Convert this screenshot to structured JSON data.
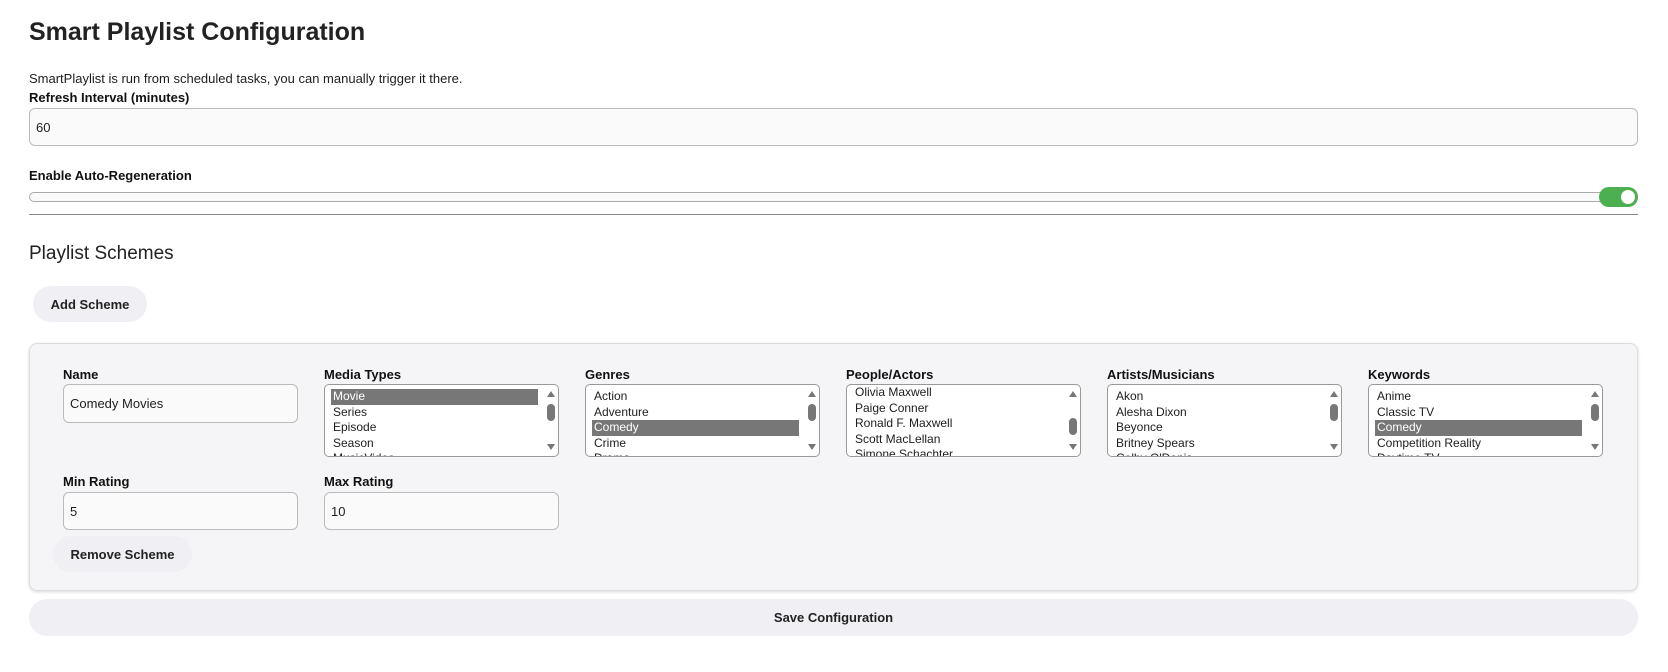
{
  "title": "Smart Playlist Configuration",
  "description": "SmartPlaylist is run from scheduled tasks, you can manually trigger it there.",
  "refresh": {
    "label": "Refresh Interval (minutes)",
    "value": "60"
  },
  "auto_regen": {
    "label": "Enable Auto-Regeneration",
    "enabled": true,
    "color": "#4caf50"
  },
  "schemes_title": "Playlist Schemes",
  "add_scheme": "Add Scheme",
  "scheme": {
    "name_label": "Name",
    "name_value": "Comedy Movies",
    "media_types": {
      "label": "Media Types",
      "options": [
        "Movie",
        "Series",
        "Episode",
        "Season",
        "MusicVideo"
      ],
      "selected": [
        "Movie"
      ]
    },
    "genres": {
      "label": "Genres",
      "options": [
        "Action",
        "Adventure",
        "Comedy",
        "Crime",
        "Drama"
      ],
      "selected": [
        "Comedy"
      ]
    },
    "people": {
      "label": "People/Actors",
      "options": [
        "Olivia Maxwell",
        "Paige Conner",
        "Ronald F. Maxwell",
        "Scott MacLellan",
        "Simone Schachter"
      ],
      "selected": []
    },
    "artists": {
      "label": "Artists/Musicians",
      "options": [
        "Akon",
        "Alesha Dixon",
        "Beyonce",
        "Britney Spears",
        "Colby O'Donis"
      ],
      "selected": []
    },
    "keywords": {
      "label": "Keywords",
      "options": [
        "Anime",
        "Classic TV",
        "Comedy",
        "Competition Reality",
        "Daytime TV"
      ],
      "selected": [
        "Comedy"
      ]
    },
    "min_label": "Min Rating",
    "min_value": "5",
    "max_label": "Max Rating",
    "max_value": "10",
    "remove": "Remove Scheme"
  },
  "save": "Save Configuration"
}
